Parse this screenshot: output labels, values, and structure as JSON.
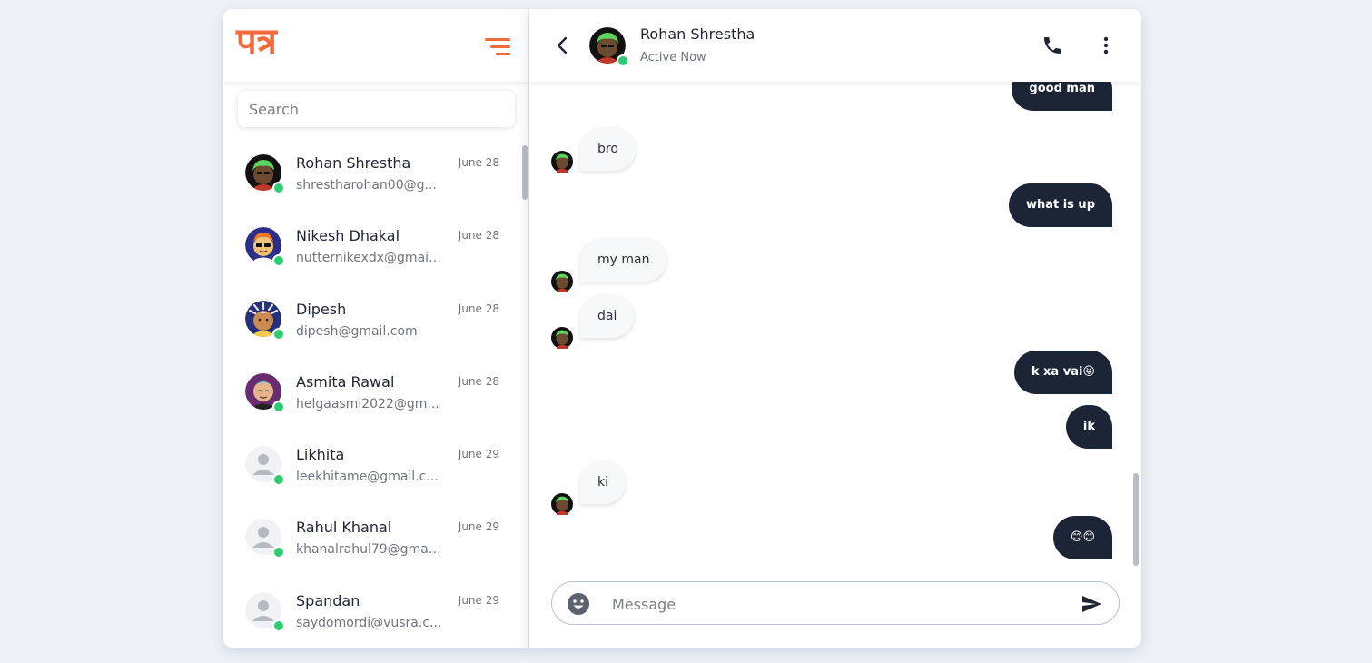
{
  "app": {
    "logo": "पत्र"
  },
  "sidebar": {
    "search_placeholder": "Search",
    "contacts": [
      {
        "name": "Rohan Shrestha",
        "email": "shrestharohan00@g...",
        "date": "June 28",
        "online": true,
        "avatar": "green-hair-avatar"
      },
      {
        "name": "Nikesh Dhakal",
        "email": "nutternikexdx@gmail....",
        "date": "June 28",
        "online": true,
        "avatar": "sunglasses-avatar"
      },
      {
        "name": "Dipesh",
        "email": "dipesh@gmail.com",
        "date": "June 28",
        "online": true,
        "avatar": "dreadlocks-avatar"
      },
      {
        "name": "Asmita Rawal",
        "email": "helgaasmi2022@gm...",
        "date": "June 28",
        "online": true,
        "avatar": "bald-avatar"
      },
      {
        "name": "Likhita",
        "email": "leekhitame@gmail.c...",
        "date": "June 29",
        "online": true,
        "avatar": "default-user-avatar"
      },
      {
        "name": "Rahul Khanal",
        "email": "khanalrahul79@gmai...",
        "date": "June 29",
        "online": true,
        "avatar": "default-user-avatar"
      },
      {
        "name": "Spandan",
        "email": "saydomordi@vusra.c...",
        "date": "June 29",
        "online": true,
        "avatar": "default-user-avatar"
      }
    ]
  },
  "chat": {
    "contact_name": "Rohan Shrestha",
    "status": "Active Now",
    "messages": [
      {
        "from": "me",
        "text": "good man"
      },
      {
        "from": "them",
        "text": "bro"
      },
      {
        "from": "me",
        "text": "what is up"
      },
      {
        "from": "them",
        "text": "my man"
      },
      {
        "from": "them",
        "text": "dai"
      },
      {
        "from": "me",
        "text": "k xa vai😝"
      },
      {
        "from": "me",
        "text": "ik"
      },
      {
        "from": "them",
        "text": "ki"
      },
      {
        "from": "me",
        "text": "😊😊"
      }
    ],
    "composer_placeholder": "Message"
  },
  "colors": {
    "accent": "#f26b3a",
    "outgoing_bubble": "#1c2536",
    "incoming_bubble": "#f7f8fa",
    "online": "#2ecc71",
    "background": "#eef2f7"
  },
  "icons": [
    "menu-icon",
    "back-icon",
    "phone-icon",
    "more-vertical-icon",
    "emoji-icon",
    "send-icon"
  ]
}
